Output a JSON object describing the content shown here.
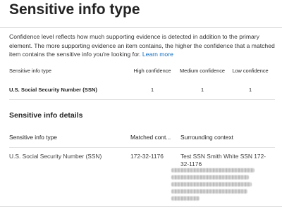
{
  "page": {
    "title": "Sensitive info type",
    "description": "Confidence level reflects how much supporting evidence is detected in addition to the primary element. The more supporting evidence an item contains, the higher the confidence that a matched item contains the sensitive info you're looking for.",
    "learn_more": "Learn more"
  },
  "summary_table": {
    "headers": {
      "type": "Sensitive info type",
      "high": "High confidence",
      "medium": "Medium confidence",
      "low": "Low confidence"
    },
    "rows": [
      {
        "type": "U.S. Social Security Number (SSN)",
        "high": "1",
        "medium": "1",
        "low": "1"
      }
    ]
  },
  "details": {
    "title": "Sensitive info details",
    "headers": {
      "type": "Sensitive info type",
      "matched": "Matched cont...",
      "context": "Surrounding context"
    },
    "rows": [
      {
        "type": "U.S. Social Security Number (SSN)",
        "matched": "172-32-1176",
        "context": "Test SSN Smith White SSN 172-32-1176"
      }
    ]
  },
  "colors": {
    "link": "#0f6cbd",
    "divider": "#d1d1d1"
  }
}
